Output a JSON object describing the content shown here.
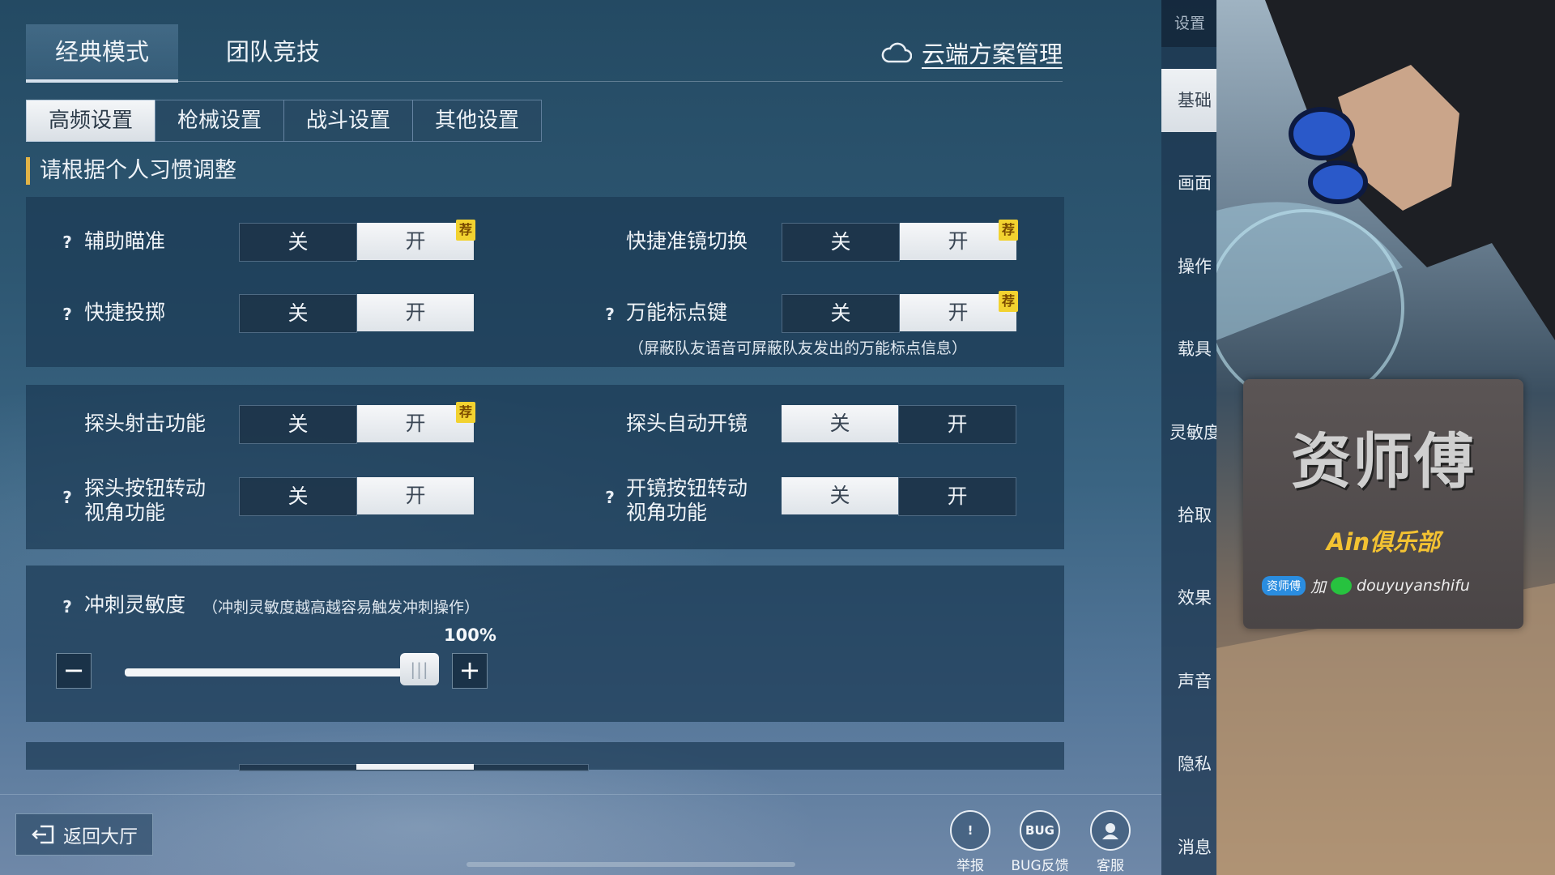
{
  "mode_tabs": [
    "经典模式",
    "团队竞技"
  ],
  "cloud_manager_label": "云端方案管理",
  "sub_tabs": [
    "高频设置",
    "枪械设置",
    "战斗设置",
    "其他设置"
  ],
  "hint_title": "请根据个人习惯调整",
  "toggle_off_label": "关",
  "toggle_on_label": "开",
  "recommend_badge": "荐",
  "help_mark": "?",
  "settings": {
    "aim_assist": {
      "label": "辅助瞄准",
      "value": "开"
    },
    "quick_scope_switch": {
      "label": "快捷准镜切换",
      "value": "开"
    },
    "quick_throw": {
      "label": "快捷投掷",
      "value": "开"
    },
    "universal_marker": {
      "label": "万能标点键",
      "value": "开",
      "note": "（屏蔽队友语音可屏蔽队友发出的万能标点信息）"
    },
    "peek_fire": {
      "label": "探头射击功能",
      "value": "开"
    },
    "peek_auto_scope": {
      "label": "探头自动开镜",
      "value": "关"
    },
    "peek_button_rotate": {
      "label_line1": "探头按钮转动",
      "label_line2": "视角功能",
      "value": "开"
    },
    "scope_button_rotate": {
      "label_line1": "开镜按钮转动",
      "label_line2": "视角功能",
      "value": "关"
    }
  },
  "sprint_sensitivity": {
    "label": "冲刺灵敏度",
    "note": "（冲刺灵敏度越高越容易触发冲刺操作）",
    "value_text": "100%",
    "value": 1.0
  },
  "bottom": {
    "back_label": "返回大厅",
    "report_label": "举报",
    "bug_icon_text": "BUG",
    "bug_label": "BUG反馈",
    "service_label": "客服"
  },
  "side_nav": {
    "header": "设置",
    "items": [
      "基础",
      "画面",
      "操作",
      "载具",
      "灵敏度",
      "拾取",
      "效果",
      "声音",
      "隐私",
      "消息"
    ]
  },
  "overlay": {
    "title": "资师傅",
    "club": "Ain俱乐部",
    "qq_label": "资师傅",
    "connector": "加",
    "wechat_id": "douyuyanshifu"
  },
  "colors": {
    "accent_bar": "#e1b347",
    "recommend_badge": "#f2d230",
    "toggle_selected": "#eef1f4"
  }
}
